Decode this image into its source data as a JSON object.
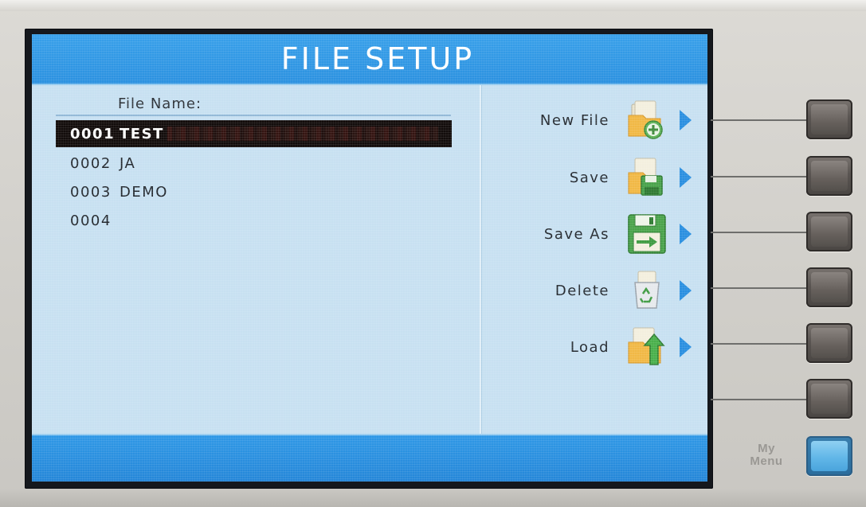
{
  "screen": {
    "title": "FILE SETUP"
  },
  "file_list": {
    "header": "File Name:",
    "rows": [
      {
        "number": "0001",
        "name": "TEST",
        "selected": true
      },
      {
        "number": "0002",
        "name": "JA",
        "selected": false
      },
      {
        "number": "0003",
        "name": "DEMO",
        "selected": false
      },
      {
        "number": "0004",
        "name": "",
        "selected": false
      }
    ]
  },
  "softkeys": [
    {
      "label": "New File",
      "icon": "new-file-icon"
    },
    {
      "label": "Save",
      "icon": "save-icon"
    },
    {
      "label": "Save As",
      "icon": "save-as-icon"
    },
    {
      "label": "Delete",
      "icon": "delete-recycle-icon"
    },
    {
      "label": "Load",
      "icon": "load-icon"
    }
  ],
  "hardware": {
    "my_menu_label_line1": "My",
    "my_menu_label_line2": "Menu"
  },
  "colors": {
    "screen_background": "#c7e0f1",
    "title_bar": "#2b91e0",
    "selection": "#120c0b",
    "softkey_arrow": "#2a8fe0",
    "my_menu_button": "#62b7e8"
  }
}
